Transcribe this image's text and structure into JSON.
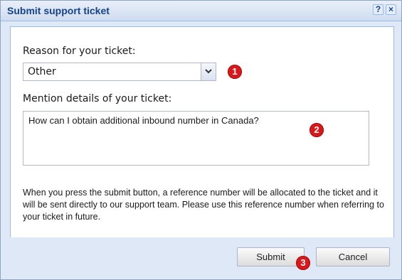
{
  "dialog": {
    "title": "Submit support ticket",
    "help_glyph": "?",
    "close_glyph": "×"
  },
  "form": {
    "reason_label": "Reason for your ticket:",
    "reason_value": "Other",
    "details_label": "Mention details of your ticket:",
    "details_value": "How can I obtain additional inbound number in Canada?",
    "info_text": "When you press the submit button, a reference number will be allocated to the ticket and it will be sent directly to our support team. Please use this reference number when referring to your ticket in future."
  },
  "buttons": {
    "submit": "Submit",
    "cancel": "Cancel"
  },
  "annotations": [
    "1",
    "2",
    "3"
  ],
  "colors": {
    "title_text": "#15428b",
    "dialog_bg": "#dfe8f6",
    "badge": "#d9181b"
  },
  "icons": {
    "help": "help-icon",
    "close": "close-icon",
    "dropdown": "chevron-down-icon"
  }
}
